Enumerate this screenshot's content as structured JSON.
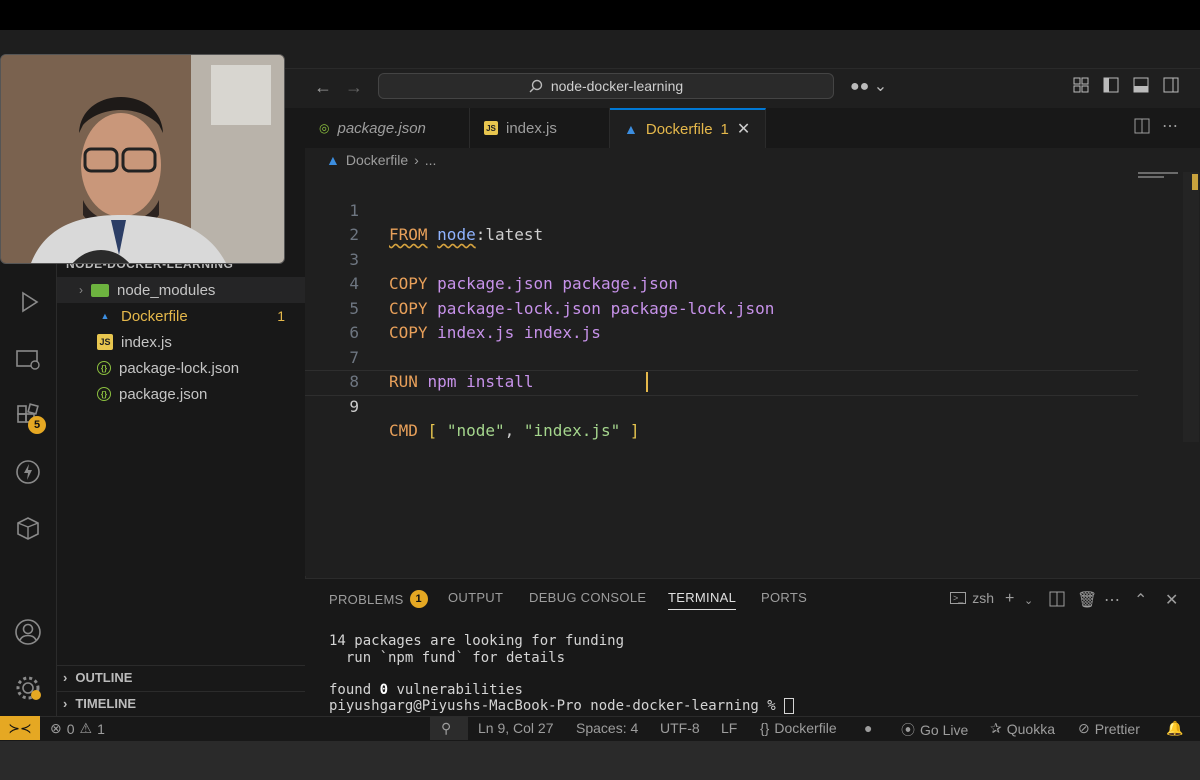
{
  "search": {
    "label": "node-docker-learning"
  },
  "tabs": [
    {
      "label": "package.json"
    },
    {
      "label": "index.js"
    },
    {
      "label": "Dockerfile",
      "problems": "1"
    }
  ],
  "breadcrumb": {
    "file": "Dockerfile",
    "more": "..."
  },
  "explorer": {
    "title": "NODE-DOCKER-LEARNING",
    "items": [
      {
        "label": "node_modules"
      },
      {
        "label": "Dockerfile",
        "badge": "1"
      },
      {
        "label": "index.js"
      },
      {
        "label": "package-lock.json"
      },
      {
        "label": "package.json"
      }
    ],
    "outline": "OUTLINE",
    "timeline": "TIMELINE"
  },
  "activity": {
    "extensions_badge": "5"
  },
  "editor": {
    "line_numbers": [
      "1",
      "2",
      "3",
      "4",
      "5",
      "6",
      "7",
      "8",
      "9"
    ],
    "lines": {
      "l1": {
        "kw": "FROM",
        "img": "node",
        "rest": ":latest"
      },
      "l3": {
        "kw": "COPY",
        "a": "package.json",
        "b": "package.json"
      },
      "l4": {
        "kw": "COPY",
        "a": "package-lock.json",
        "b": "package-lock.json"
      },
      "l5": {
        "kw": "COPY",
        "a": "index.js",
        "b": "index.js"
      },
      "l7": {
        "kw": "RUN",
        "a": "npm",
        "b": "install"
      },
      "l9": {
        "kw": "CMD",
        "open": "[",
        "s1": "\"node\"",
        "comma": ",",
        "s2": "\"index.js\"",
        "close": "]"
      }
    }
  },
  "panel": {
    "tabs": {
      "problems": "PROBLEMS",
      "problems_count": "1",
      "output": "OUTPUT",
      "debug": "DEBUG CONSOLE",
      "terminal": "TERMINAL",
      "ports": "PORTS"
    },
    "shell": "zsh",
    "terminal_lines": [
      "14 packages are looking for funding",
      "  run `npm fund` for details",
      "",
      "found ",
      "piyushgarg@Piyushs-MacBook-Pro node-docker-learning % "
    ],
    "vuln_count": "0",
    "vuln_text": " vulnerabilities"
  },
  "status": {
    "errors": "0",
    "warnings": "1",
    "position": "Ln 9, Col 27",
    "spaces": "Spaces: 4",
    "encoding": "UTF-8",
    "eol": "LF",
    "language": "Dockerfile",
    "golive": "Go Live",
    "quokka": "Quokka",
    "prettier": "Prettier"
  },
  "colors": {
    "accent": "#e5a823",
    "keyword": "#e8a05a",
    "string": "#a5d68d",
    "argument": "#c792ea",
    "active_tab_text": "#e5b84b"
  }
}
